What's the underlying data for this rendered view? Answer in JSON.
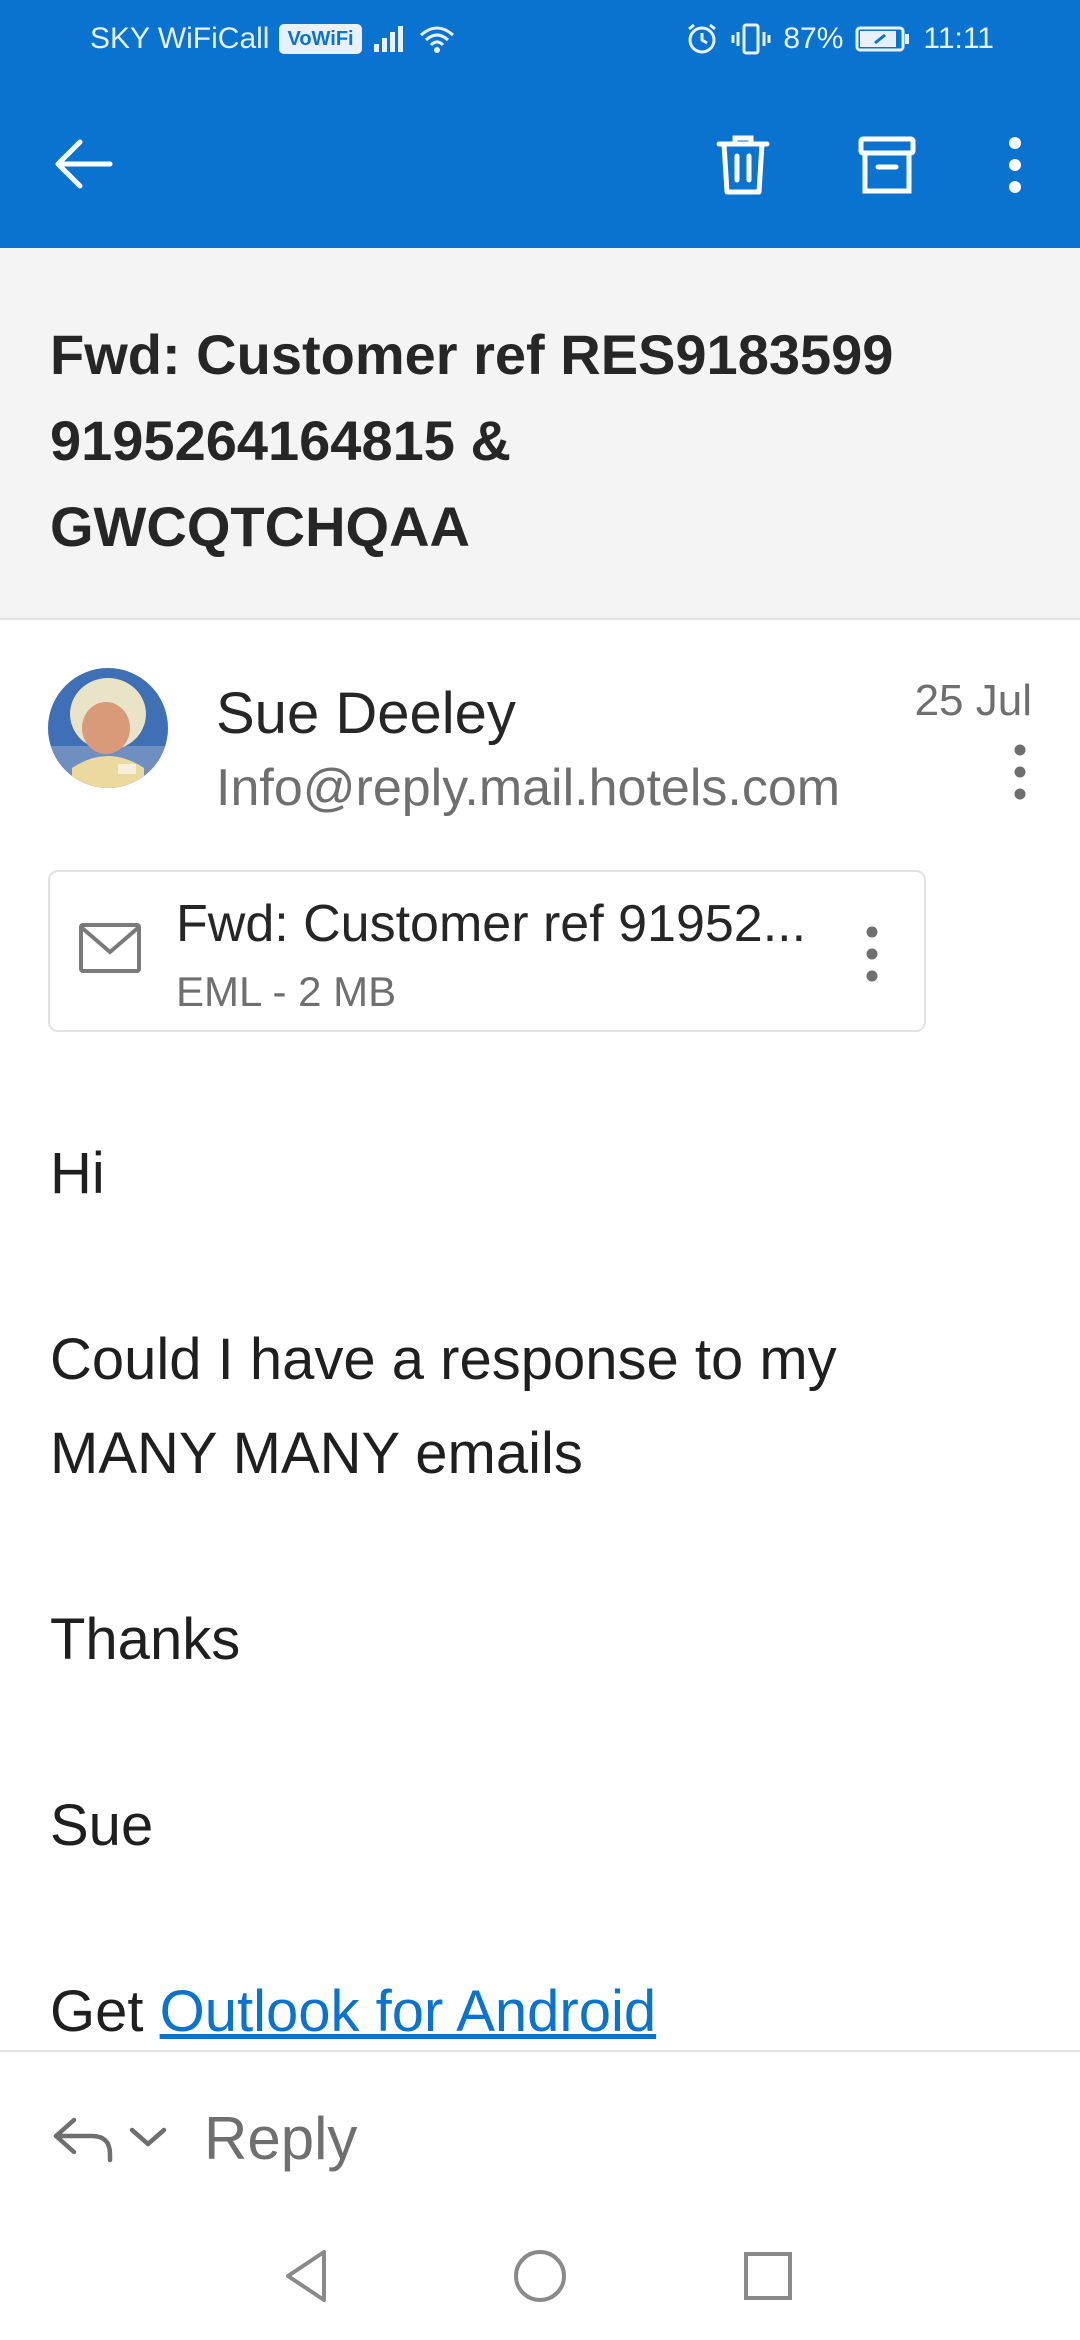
{
  "status_bar": {
    "carrier": "SKY WiFiCall",
    "vowifi_badge": "VoWiFi",
    "battery": "87%",
    "time": "11:11"
  },
  "app_bar": {
    "back_icon": "arrow-left-icon",
    "delete_icon": "trash-icon",
    "archive_icon": "archive-icon",
    "more_icon": "more-vertical-icon",
    "background_color": "#0a72cf"
  },
  "message": {
    "subject_lines": [
      "Fwd: Customer ref RES9183599",
      "9195264164815 &",
      "GWCQTCHQAA"
    ],
    "sender_name": "Sue Deeley",
    "sender_email": "Info@reply.mail.hotels.com",
    "date": "25 Jul"
  },
  "attachment": {
    "name": "Fwd: Customer ref 91952...",
    "meta": "EML - 2 MB",
    "icon": "envelope-icon"
  },
  "body": {
    "greeting": "Hi",
    "line1": "Could I have a response to my",
    "line2": "MANY MANY emails",
    "thanks": "Thanks",
    "signature": "Sue",
    "footer_prefix": "Get ",
    "footer_link": "Outlook for Android"
  },
  "reply_bar": {
    "label": "Reply",
    "icon": "reply-icon"
  },
  "nav_bar": {
    "back_icon": "triangle-back-icon",
    "home_icon": "circle-home-icon",
    "recents_icon": "square-recents-icon"
  },
  "colors": {
    "accent": "#0a72cf",
    "link": "#0a72cf",
    "secondary_text": "#6f6f6f"
  }
}
